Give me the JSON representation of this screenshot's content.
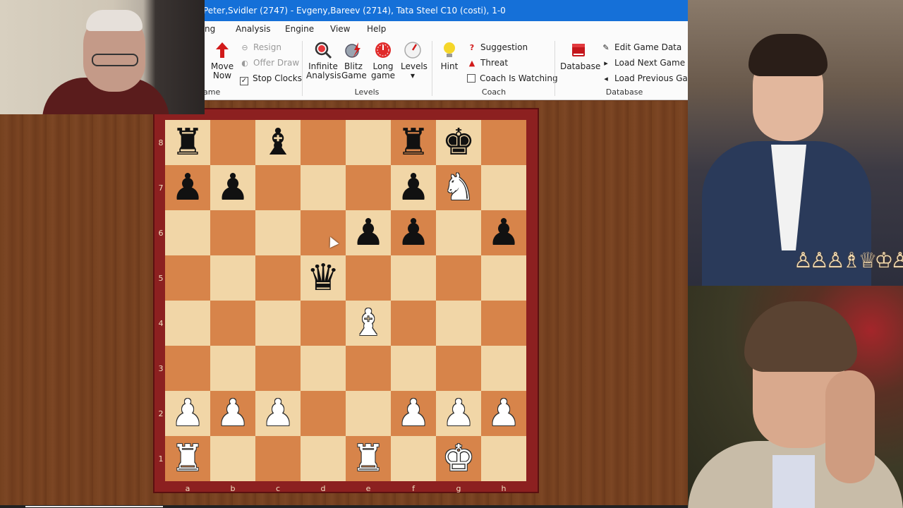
{
  "window": {
    "title": "Peter,Svidler (2747) - Evgeny,Bareev (2714), Tata Steel  C10  (costi), 1-0"
  },
  "menu": {
    "items": [
      "ng",
      "Analysis",
      "Engine",
      "View",
      "Help"
    ]
  },
  "ribbon": {
    "resign": "Resign",
    "offer_draw": "Offer Draw",
    "stop_clocks": "Stop Clocks",
    "stop_clocks_checked": true,
    "move_now": "Move Now",
    "game_group_partial": "ame",
    "infinite_analysis": "Infinite Analysis",
    "blitz_game": "Blitz Game",
    "long_game": "Long game",
    "levels": "Levels",
    "levels_group": "Levels",
    "hint": "Hint",
    "suggestion": "Suggestion",
    "threat": "Threat",
    "coach_is_watching": "Coach Is Watching",
    "coach_group": "Coach",
    "database": "Database",
    "edit_game_data": "Edit Game Data",
    "load_next_game": "Load Next Game",
    "load_previous_game": "Load Previous Game",
    "database_group": "Database"
  },
  "board": {
    "files": [
      "a",
      "b",
      "c",
      "d",
      "e",
      "f",
      "g",
      "h"
    ],
    "ranks": [
      "8",
      "7",
      "6",
      "5",
      "4",
      "3",
      "2",
      "1"
    ],
    "position": [
      [
        "br",
        "",
        "bb",
        "",
        "",
        "br",
        "bk",
        ""
      ],
      [
        "bp",
        "bp",
        "",
        "",
        "",
        "bp",
        "wn",
        ""
      ],
      [
        "",
        "",
        "",
        "",
        "bp",
        "bp",
        "",
        "bp"
      ],
      [
        "",
        "",
        "",
        "bq",
        "",
        "",
        "",
        ""
      ],
      [
        "",
        "",
        "",
        "",
        "wb",
        "",
        "",
        ""
      ],
      [
        "",
        "",
        "",
        "",
        "",
        "",
        "",
        ""
      ],
      [
        "wp",
        "wp",
        "wp",
        "",
        "",
        "wp",
        "wp",
        "wp"
      ],
      [
        "wr",
        "",
        "",
        "",
        "wr",
        "",
        "wk",
        ""
      ]
    ],
    "colors": {
      "light": "#f1d6a7",
      "dark": "#d7844a",
      "frame": "#8c2020"
    }
  },
  "playback_progress": 0.2,
  "colors": {
    "titlebar": "#1570d8",
    "accent_red": "#d11a1a"
  }
}
